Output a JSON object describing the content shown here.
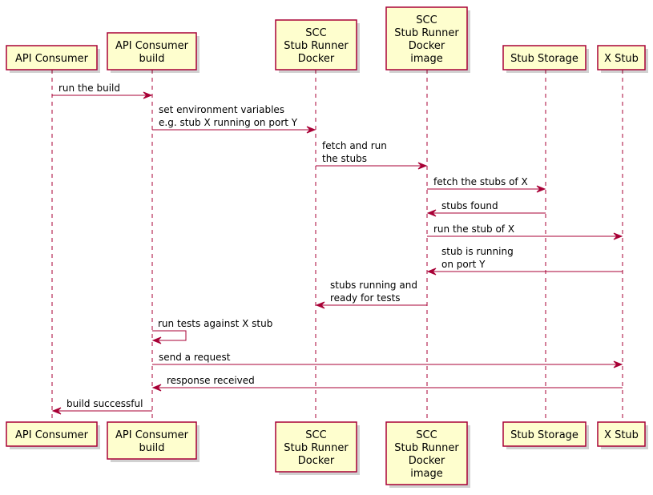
{
  "diagram": {
    "type": "sequence",
    "colors": {
      "participant_fill": "#FEFECE",
      "participant_border": "#A80036",
      "arrow": "#A80036",
      "lifeline": "#A80036",
      "text": "#000000"
    },
    "participants": [
      {
        "id": "consumer",
        "lines": [
          "API Consumer"
        ]
      },
      {
        "id": "build",
        "lines": [
          "API Consumer",
          "build"
        ]
      },
      {
        "id": "scc",
        "lines": [
          "SCC",
          "Stub Runner",
          "Docker"
        ]
      },
      {
        "id": "image",
        "lines": [
          "SCC",
          "Stub Runner",
          "Docker",
          "image"
        ]
      },
      {
        "id": "storage",
        "lines": [
          "Stub Storage"
        ]
      },
      {
        "id": "xstub",
        "lines": [
          "X Stub"
        ]
      }
    ],
    "messages": [
      {
        "from": "consumer",
        "to": "build",
        "lines": [
          "run the build"
        ]
      },
      {
        "from": "build",
        "to": "scc",
        "lines": [
          "set environment variables",
          "e.g. stub X running on port Y"
        ]
      },
      {
        "from": "scc",
        "to": "image",
        "lines": [
          "fetch and run",
          "the stubs"
        ]
      },
      {
        "from": "image",
        "to": "storage",
        "lines": [
          "fetch the stubs of X"
        ]
      },
      {
        "from": "storage",
        "to": "image",
        "lines": [
          "stubs found"
        ]
      },
      {
        "from": "image",
        "to": "xstub",
        "lines": [
          "run the stub of X"
        ]
      },
      {
        "from": "xstub",
        "to": "image",
        "lines": [
          "stub is running",
          "on port Y"
        ]
      },
      {
        "from": "image",
        "to": "scc",
        "lines": [
          "stubs running and",
          "ready for tests"
        ]
      },
      {
        "from": "build",
        "to": "build",
        "lines": [
          "run tests against X stub"
        ]
      },
      {
        "from": "build",
        "to": "xstub",
        "lines": [
          "send a request"
        ]
      },
      {
        "from": "xstub",
        "to": "build",
        "lines": [
          "response received"
        ]
      },
      {
        "from": "build",
        "to": "consumer",
        "lines": [
          "build successful"
        ]
      }
    ]
  }
}
